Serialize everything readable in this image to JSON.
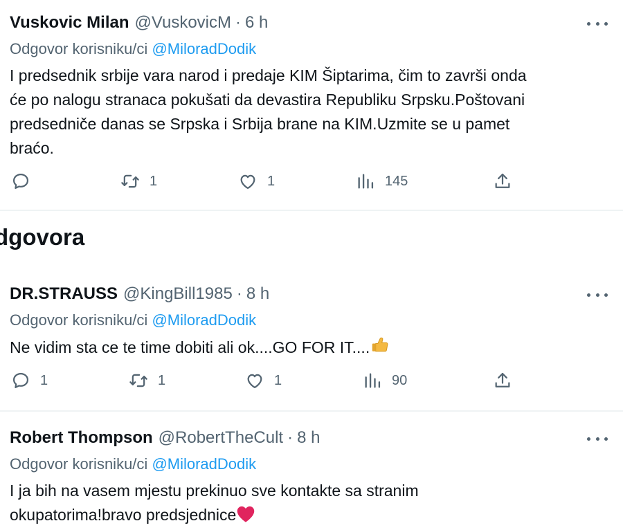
{
  "tweets": [
    {
      "name": "Vuskovic Milan",
      "handle": "@VuskovicM",
      "dot": "·",
      "time": "6 h",
      "reply_prefix": "Odgovor korisniku/ci",
      "reply_mention": "@MiloradDodik",
      "text_lines": [
        "I predsednik srbije vara narod i predaje KIM Šiptarima, čim to završi onda",
        "će po nalogu stranaca pokušati da devastira Republiku Srpsku.Poštovani",
        "predsedniče danas se Srpska i Srbija brane na KIM.Uzmite se u pamet",
        "braćo."
      ],
      "replies": "",
      "retweets": "1",
      "likes": "1",
      "views": "145"
    },
    {
      "name": "DR.STRAUSS",
      "handle": "@KingBill1985",
      "dot": "·",
      "time": "8 h",
      "reply_prefix": "Odgovor korisniku/ci",
      "reply_mention": "@MiloradDodik",
      "text": "Ne vidim sta ce te time dobiti ali ok....GO FOR IT....",
      "text_emoji": "thumbs-up",
      "replies": "1",
      "retweets": "1",
      "likes": "1",
      "views": "90"
    },
    {
      "name": "Robert Thompson",
      "handle": "@RobertTheCult",
      "dot": "·",
      "time": "8 h",
      "reply_prefix": "Odgovor korisniku/ci",
      "reply_mention": "@MiloradDodik",
      "text_lines": [
        "I ja bih na vasem mjestu prekinuo sve kontakte sa stranim",
        "okupatorima!bravo predsjednice"
      ],
      "text_emoji": "red-heart"
    }
  ],
  "section": {
    "title": "dgovora"
  },
  "icons": {
    "reply": "reply-icon",
    "retweet": "retweet-icon",
    "like": "heart-icon",
    "views": "views-icon",
    "share": "share-icon",
    "more": "more-icon"
  },
  "colors": {
    "text": "#0f1419",
    "secondary": "#536471",
    "link": "#1d9bf0",
    "divider": "#eff3f4",
    "heart_emoji": "#e0245e",
    "thumb_emoji": "#f4b942"
  }
}
